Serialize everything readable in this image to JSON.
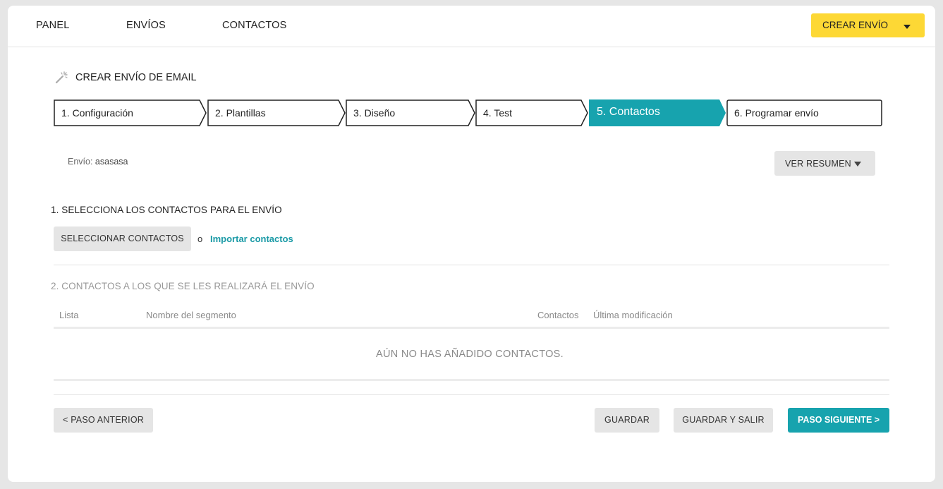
{
  "nav": {
    "items": [
      {
        "label": "PANEL"
      },
      {
        "label": "ENVÍOS"
      },
      {
        "label": "CONTACTOS"
      }
    ],
    "create_button": "CREAR ENVÍO"
  },
  "page": {
    "title": "CREAR ENVÍO DE EMAIL",
    "title_icon": "magic-wand-icon"
  },
  "steps": [
    {
      "label": "1. Configuración",
      "active": false
    },
    {
      "label": "2. Plantillas",
      "active": false
    },
    {
      "label": "3. Diseño",
      "active": false
    },
    {
      "label": "4. Test",
      "active": false
    },
    {
      "label": "5. Contactos",
      "active": true
    },
    {
      "label": "6. Programar envío",
      "active": false
    }
  ],
  "envio": {
    "prefix": "Envío:",
    "name": "asasasa"
  },
  "summary_button": "VER RESUMEN",
  "section1": {
    "title": "1. SELECCIONA LOS CONTACTOS PARA EL ENVÍO",
    "select_button": "SELECCIONAR CONTACTOS",
    "or_text": "o",
    "import_link": "Importar contactos"
  },
  "section2": {
    "title": "2. CONTACTOS A LOS QUE SE LES REALIZARÁ EL ENVÍO",
    "columns": [
      "Lista",
      "Nombre del segmento",
      "Contactos",
      "Última modificación"
    ],
    "empty_message": "AÚN NO HAS AÑADIDO CONTACTOS."
  },
  "footer": {
    "prev": "< PASO ANTERIOR",
    "save": "GUARDAR",
    "save_exit": "GUARDAR Y SALIR",
    "next": "PASO SIGUIENTE >"
  },
  "colors": {
    "accent": "#17a3ae",
    "create_button": "#fdd835"
  }
}
